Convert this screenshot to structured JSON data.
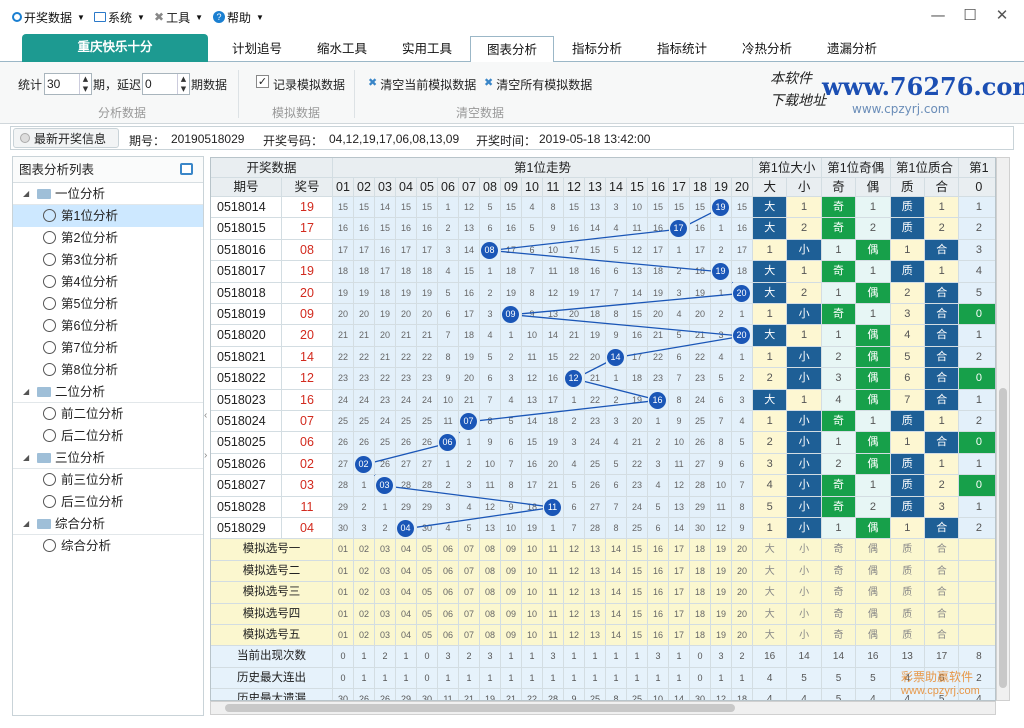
{
  "menubar": {
    "items": [
      {
        "label": "开奖数据",
        "icon": "circle-icon"
      },
      {
        "label": "系统",
        "icon": "monitor-icon"
      },
      {
        "label": "工具",
        "icon": "tools-icon"
      },
      {
        "label": "帮助",
        "icon": "help-icon"
      }
    ],
    "window_controls": [
      "—",
      "☐",
      "✕"
    ]
  },
  "tabs": {
    "brand": "重庆快乐十分",
    "items": [
      "计划追号",
      "缩水工具",
      "实用工具",
      "图表分析",
      "指标分析",
      "指标统计",
      "冷热分析",
      "遗漏分析"
    ],
    "active_index": 3
  },
  "toolbar": {
    "stat_label": "统计",
    "stat_value": "30",
    "period_label": "期，延迟",
    "delay_value": "0",
    "data_label": "期数据",
    "group1_label": "分析数据",
    "record_label": "记录模拟数据",
    "record_checked": true,
    "group2_label": "模拟数据",
    "clear_current": "清空当前模拟数据",
    "clear_all": "清空所有模拟数据",
    "group3_label": "清空数据",
    "logo_text": "www.76276.com",
    "logo_sub": "www.cpzyrj.com",
    "logo_hand": "本软件 下载地址"
  },
  "infobar": {
    "button": "最新开奖信息",
    "issue_label": "期号：",
    "issue": "20190518029",
    "code_label": "开奖号码：",
    "code": "04,12,19,17,06,08,13,09",
    "time_label": "开奖时间：",
    "time": "2019-05-18 13:42:00"
  },
  "sidebar": {
    "title": "图表分析列表",
    "tree": [
      {
        "label": "一位分析",
        "level": 0
      },
      {
        "label": "第1位分析",
        "level": 1,
        "selected": true
      },
      {
        "label": "第2位分析",
        "level": 1
      },
      {
        "label": "第3位分析",
        "level": 1
      },
      {
        "label": "第4位分析",
        "level": 1
      },
      {
        "label": "第5位分析",
        "level": 1
      },
      {
        "label": "第6位分析",
        "level": 1
      },
      {
        "label": "第7位分析",
        "level": 1
      },
      {
        "label": "第8位分析",
        "level": 1
      },
      {
        "label": "二位分析",
        "level": 0
      },
      {
        "label": "前二位分析",
        "level": 1
      },
      {
        "label": "后二位分析",
        "level": 1
      },
      {
        "label": "三位分析",
        "level": 0
      },
      {
        "label": "前三位分析",
        "level": 1
      },
      {
        "label": "后三位分析",
        "level": 1
      },
      {
        "label": "综合分析",
        "level": 0
      },
      {
        "label": "综合分析",
        "level": 1
      }
    ]
  },
  "grid": {
    "header_group": {
      "left": "开奖数据",
      "trend": "第1位走势",
      "size": "第1位大小",
      "parity": "第1位奇偶",
      "prime": "第1位质合",
      "more": "第1"
    },
    "header_cols": {
      "issue": "期号",
      "number": "奖号",
      "trend_nums": [
        "01",
        "02",
        "03",
        "04",
        "05",
        "06",
        "07",
        "08",
        "09",
        "10",
        "11",
        "12",
        "13",
        "14",
        "15",
        "16",
        "17",
        "18",
        "19",
        "20"
      ],
      "size": [
        "大",
        "小"
      ],
      "parity": [
        "奇",
        "偶"
      ],
      "prime": [
        "质",
        "合"
      ],
      "more": "0"
    },
    "rows": [
      {
        "issue": "0518014",
        "num": "19",
        "trend": [
          "15",
          "15",
          "14",
          "15",
          "15",
          "1",
          "12",
          "5",
          "15",
          "4",
          "8",
          "15",
          "13",
          "3",
          "10",
          "15",
          "15",
          "15",
          "19",
          "15"
        ],
        "size": [
          "大",
          "1"
        ],
        "parity": [
          "奇",
          "1"
        ],
        "prime": [
          "质",
          "1"
        ],
        "more": "1"
      },
      {
        "issue": "0518015",
        "num": "17",
        "trend": [
          "16",
          "16",
          "15",
          "16",
          "16",
          "2",
          "13",
          "6",
          "16",
          "5",
          "9",
          "16",
          "14",
          "4",
          "11",
          "16",
          "17",
          "16",
          "1",
          "16"
        ],
        "size": [
          "大",
          "2"
        ],
        "parity": [
          "奇",
          "2"
        ],
        "prime": [
          "质",
          "2"
        ],
        "more": "2"
      },
      {
        "issue": "0518016",
        "num": "08",
        "trend": [
          "17",
          "17",
          "16",
          "17",
          "17",
          "3",
          "14",
          "08",
          "17",
          "6",
          "10",
          "17",
          "15",
          "5",
          "12",
          "17",
          "1",
          "17",
          "2",
          "17"
        ],
        "size": [
          "1",
          "小"
        ],
        "parity": [
          "1",
          "偶"
        ],
        "prime": [
          "1",
          "合"
        ],
        "more": "3"
      },
      {
        "issue": "0518017",
        "num": "19",
        "trend": [
          "18",
          "18",
          "17",
          "18",
          "18",
          "4",
          "15",
          "1",
          "18",
          "7",
          "11",
          "18",
          "16",
          "6",
          "13",
          "18",
          "2",
          "18",
          "19",
          "18"
        ],
        "size": [
          "大",
          "1"
        ],
        "parity": [
          "奇",
          "1"
        ],
        "prime": [
          "质",
          "1"
        ],
        "more": "4"
      },
      {
        "issue": "0518018",
        "num": "20",
        "trend": [
          "19",
          "19",
          "18",
          "19",
          "19",
          "5",
          "16",
          "2",
          "19",
          "8",
          "12",
          "19",
          "17",
          "7",
          "14",
          "19",
          "3",
          "19",
          "1",
          "20"
        ],
        "size": [
          "大",
          "2"
        ],
        "parity": [
          "1",
          "偶"
        ],
        "prime": [
          "2",
          "合"
        ],
        "more": "5"
      },
      {
        "issue": "0518019",
        "num": "09",
        "trend": [
          "20",
          "20",
          "19",
          "20",
          "20",
          "6",
          "17",
          "3",
          "09",
          "9",
          "13",
          "20",
          "18",
          "8",
          "15",
          "20",
          "4",
          "20",
          "2",
          "1"
        ],
        "size": [
          "1",
          "小"
        ],
        "parity": [
          "奇",
          "1"
        ],
        "prime": [
          "3",
          "合"
        ],
        "more": "0"
      },
      {
        "issue": "0518020",
        "num": "20",
        "trend": [
          "21",
          "21",
          "20",
          "21",
          "21",
          "7",
          "18",
          "4",
          "1",
          "10",
          "14",
          "21",
          "19",
          "9",
          "16",
          "21",
          "5",
          "21",
          "3",
          "20"
        ],
        "size": [
          "大",
          "1"
        ],
        "parity": [
          "1",
          "偶"
        ],
        "prime": [
          "4",
          "合"
        ],
        "more": "1"
      },
      {
        "issue": "0518021",
        "num": "14",
        "trend": [
          "22",
          "22",
          "21",
          "22",
          "22",
          "8",
          "19",
          "5",
          "2",
          "11",
          "15",
          "22",
          "20",
          "14",
          "17",
          "22",
          "6",
          "22",
          "4",
          "1"
        ],
        "size": [
          "1",
          "小"
        ],
        "parity": [
          "2",
          "偶"
        ],
        "prime": [
          "5",
          "合"
        ],
        "more": "2"
      },
      {
        "issue": "0518022",
        "num": "12",
        "trend": [
          "23",
          "23",
          "22",
          "23",
          "23",
          "9",
          "20",
          "6",
          "3",
          "12",
          "16",
          "12",
          "21",
          "1",
          "18",
          "23",
          "7",
          "23",
          "5",
          "2"
        ],
        "size": [
          "2",
          "小"
        ],
        "parity": [
          "3",
          "偶"
        ],
        "prime": [
          "6",
          "合"
        ],
        "more": "0"
      },
      {
        "issue": "0518023",
        "num": "16",
        "trend": [
          "24",
          "24",
          "23",
          "24",
          "24",
          "10",
          "21",
          "7",
          "4",
          "13",
          "17",
          "1",
          "22",
          "2",
          "19",
          "16",
          "8",
          "24",
          "6",
          "3"
        ],
        "size": [
          "大",
          "1"
        ],
        "parity": [
          "4",
          "偶"
        ],
        "prime": [
          "7",
          "合"
        ],
        "more": "1"
      },
      {
        "issue": "0518024",
        "num": "07",
        "trend": [
          "25",
          "25",
          "24",
          "25",
          "25",
          "11",
          "07",
          "8",
          "5",
          "14",
          "18",
          "2",
          "23",
          "3",
          "20",
          "1",
          "9",
          "25",
          "7",
          "4"
        ],
        "size": [
          "1",
          "小"
        ],
        "parity": [
          "奇",
          "1"
        ],
        "prime": [
          "质",
          "1"
        ],
        "more": "2"
      },
      {
        "issue": "0518025",
        "num": "06",
        "trend": [
          "26",
          "26",
          "25",
          "26",
          "26",
          "06",
          "1",
          "9",
          "6",
          "15",
          "19",
          "3",
          "24",
          "4",
          "21",
          "2",
          "10",
          "26",
          "8",
          "5"
        ],
        "size": [
          "2",
          "小"
        ],
        "parity": [
          "1",
          "偶"
        ],
        "prime": [
          "1",
          "合"
        ],
        "more": "0"
      },
      {
        "issue": "0518026",
        "num": "02",
        "trend": [
          "27",
          "02",
          "26",
          "27",
          "27",
          "1",
          "2",
          "10",
          "7",
          "16",
          "20",
          "4",
          "25",
          "5",
          "22",
          "3",
          "11",
          "27",
          "9",
          "6"
        ],
        "size": [
          "3",
          "小"
        ],
        "parity": [
          "2",
          "偶"
        ],
        "prime": [
          "质",
          "1"
        ],
        "more": "1"
      },
      {
        "issue": "0518027",
        "num": "03",
        "trend": [
          "28",
          "1",
          "03",
          "28",
          "28",
          "2",
          "3",
          "11",
          "8",
          "17",
          "21",
          "5",
          "26",
          "6",
          "23",
          "4",
          "12",
          "28",
          "10",
          "7"
        ],
        "size": [
          "4",
          "小"
        ],
        "parity": [
          "奇",
          "1"
        ],
        "prime": [
          "质",
          "2"
        ],
        "more": "0"
      },
      {
        "issue": "0518028",
        "num": "11",
        "trend": [
          "29",
          "2",
          "1",
          "29",
          "29",
          "3",
          "4",
          "12",
          "9",
          "18",
          "11",
          "6",
          "27",
          "7",
          "24",
          "5",
          "13",
          "29",
          "11",
          "8"
        ],
        "size": [
          "5",
          "小"
        ],
        "parity": [
          "奇",
          "2"
        ],
        "prime": [
          "质",
          "3"
        ],
        "more": "1"
      },
      {
        "issue": "0518029",
        "num": "04",
        "trend": [
          "30",
          "3",
          "2",
          "04",
          "30",
          "4",
          "5",
          "13",
          "10",
          "19",
          "1",
          "7",
          "28",
          "8",
          "25",
          "6",
          "14",
          "30",
          "12",
          "9"
        ],
        "size": [
          "1",
          "小"
        ],
        "parity": [
          "1",
          "偶"
        ],
        "prime": [
          "1",
          "合"
        ],
        "more": "2"
      }
    ],
    "sim_rows": [
      {
        "label": "模拟选号一"
      },
      {
        "label": "模拟选号二"
      },
      {
        "label": "模拟选号三"
      },
      {
        "label": "模拟选号四"
      },
      {
        "label": "模拟选号五"
      }
    ],
    "stats": [
      {
        "label": "当前出现次数",
        "trend": [
          "0",
          "1",
          "2",
          "1",
          "0",
          "3",
          "2",
          "3",
          "1",
          "1",
          "3",
          "1",
          "1",
          "1",
          "1",
          "3",
          "1",
          "0",
          "3",
          "2"
        ],
        "rest": [
          "16",
          "14",
          "14",
          "16",
          "13",
          "17",
          "8"
        ]
      },
      {
        "label": "历史最大连出",
        "trend": [
          "0",
          "1",
          "1",
          "1",
          "0",
          "1",
          "1",
          "1",
          "1",
          "1",
          "1",
          "1",
          "1",
          "1",
          "1",
          "1",
          "1",
          "0",
          "1",
          "1"
        ],
        "rest": [
          "4",
          "5",
          "5",
          "5",
          "4",
          "6",
          "2"
        ]
      },
      {
        "label": "历史最大遗漏",
        "trend": [
          "30",
          "26",
          "26",
          "29",
          "30",
          "11",
          "21",
          "19",
          "21",
          "22",
          "28",
          "9",
          "25",
          "8",
          "25",
          "10",
          "14",
          "30",
          "12",
          "18"
        ],
        "rest": [
          "4",
          "4",
          "5",
          "4",
          "4",
          "5",
          "4"
        ]
      }
    ],
    "watermark1": "彩票助赢软件",
    "watermark2": "www.cpzyrj.com"
  },
  "colors": {
    "brand": "#1d9a91",
    "ball": "#1a56b7",
    "big": "#1e5f96",
    "green": "#17a04a",
    "red": "#d22a1e",
    "cellbg": "#e3f0fa",
    "sim": "#fbf7cf",
    "stat": "#e6f2fb"
  }
}
